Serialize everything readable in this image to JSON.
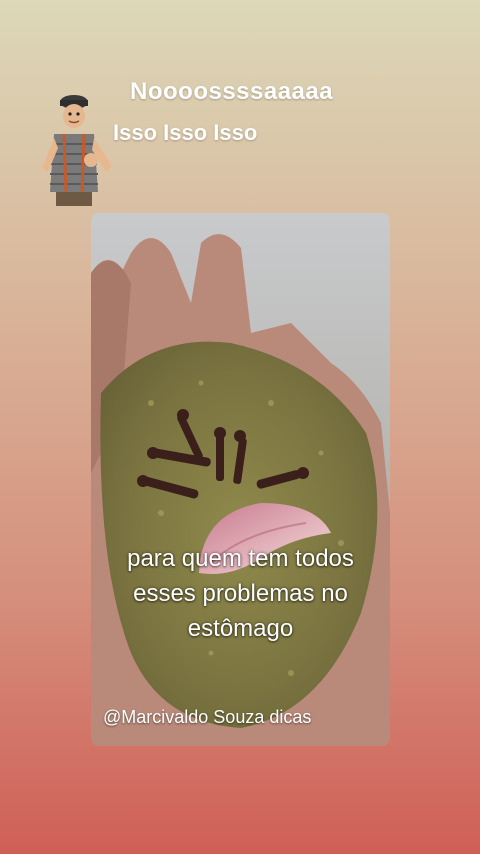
{
  "story": {
    "headline": "Noooossssaaaaa",
    "subline": "Isso Isso Isso"
  },
  "sticker": {
    "icon": "cartoon-character-sticker-icon"
  },
  "media": {
    "caption_line1": "para quem tem todos",
    "caption_line2": "esses problemas no",
    "caption_line3": "estômago",
    "credit": "@Marcivaldo Souza dicas"
  },
  "colors": {
    "background_top": "#dcd8b8",
    "background_bottom": "#cf5f57",
    "text": "#ffffff"
  }
}
